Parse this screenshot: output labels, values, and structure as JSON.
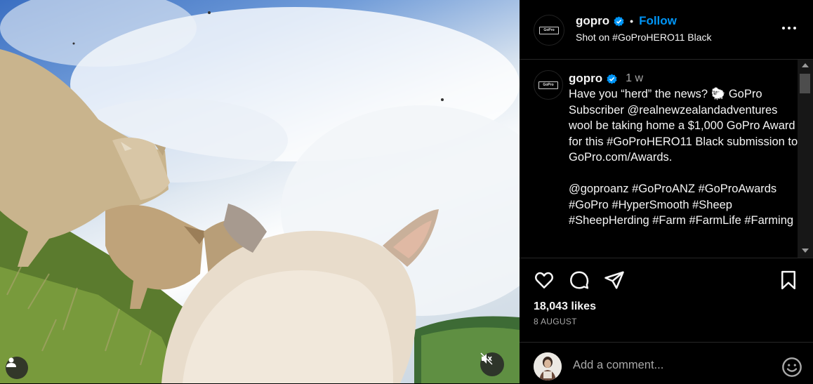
{
  "post": {
    "username": "gopro",
    "follow_label": "Follow",
    "dot": "•",
    "location": "Shot on #GoProHERO11 Black",
    "logo_text": "GoPro"
  },
  "caption": {
    "username": "gopro",
    "time": "1 w",
    "text": "Have you “herd” the news? 🐑 GoPro Subscriber @realnewzealandadventures wool be taking home a $1,000 GoPro Award for this #GoProHERO11 Black submission to GoPro.com/Awards.\n\n@goproanz #GoProANZ #GoProAwards #GoPro #HyperSmooth #Sheep #SheepHerding #Farm #FarmLife #Farming"
  },
  "stats": {
    "likes": "18,043 likes",
    "date": "8 AUGUST"
  },
  "comment_box": {
    "placeholder": "Add a comment..."
  },
  "icons": {
    "verified": "verified-badge-icon",
    "like": "heart-icon",
    "comment": "comment-icon",
    "share": "send-icon",
    "save": "bookmark-icon",
    "more": "more-options-icon",
    "mute": "speaker-muted-icon",
    "tag": "user-tag-icon",
    "emoji": "emoji-icon"
  },
  "colors": {
    "accent": "#0095f6",
    "verified": "#0095f6",
    "background": "#000000"
  }
}
